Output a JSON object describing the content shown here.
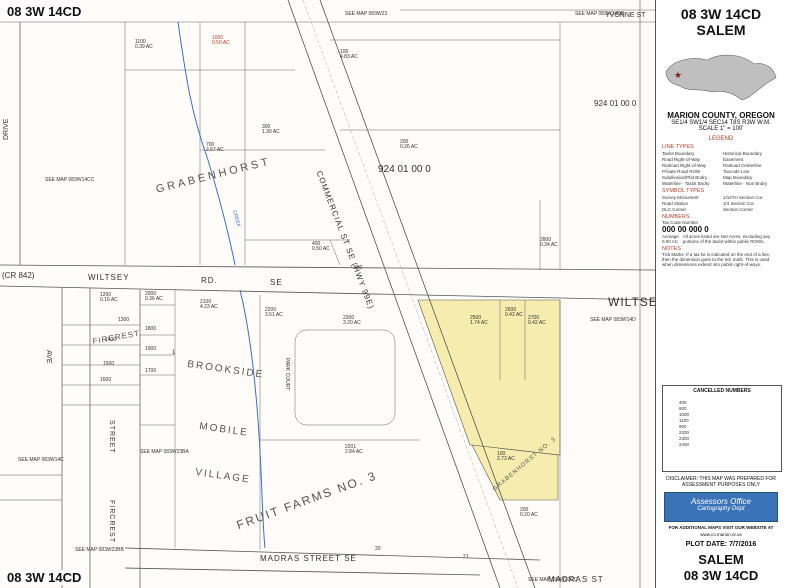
{
  "map_id": "08 3W 14CD",
  "city": "SALEM",
  "county": "MARION COUNTY, OREGON",
  "section_line": "SE1/4 SW1/4 SEC14 T8S R3W W.M.",
  "scale": "SCALE 1\" = 100'",
  "legend_title": "LEGEND",
  "line_types_title": "LINE TYPES",
  "line_types": [
    "Taxlot Boundary",
    "Historical Boundary",
    "Road Right-of-Way",
    "Easement",
    "Railroad Right-of-Way",
    "Railroad Centerline",
    "Private Road ROW",
    "Taxcode Line",
    "Subdivision/Plat Bndry",
    "Map Boundary",
    "Waterline - Taxlot Bndry",
    "Waterline - Non Bndry"
  ],
  "symbol_types_title": "SYMBOL TYPES",
  "symbol_types": [
    "Survey Monument",
    "1/16TH Section Cor",
    "Road Station",
    "1/4 Section Cor",
    "DLC Corner",
    "Section Corner"
  ],
  "numbers_title": "NUMBERS",
  "taxcode_label": "Tax Code Number",
  "taxcode": "000 00 000 0",
  "acreage_label": "Acreage",
  "acreage_sample": "0.00 AC",
  "acreage_note": "All acres listed are Net Acres, excluding any portions of the taxlot within public ROWs.",
  "notes_title": "NOTES",
  "notes_text": "Tick Marks: If a tax lot is indicated on the end of a line, then the dimension goes to the tick mark. This is used when dimensions extend into public right-of-ways.",
  "cancelled_title": "CANCELLED NUMBERS",
  "cancelled": [
    "400",
    "800",
    "1000",
    "1100",
    "900",
    "2200",
    "2300",
    "2400"
  ],
  "disclaimer": "DISCLAIMER: THIS MAP WAS PREPARED FOR ASSESSMENT PURPOSES ONLY",
  "badge_title": "Assessors Office",
  "badge_subtitle": "Cartography Dept",
  "web_note": "FOR ADDITIONAL MAPS VISIT OUR WEBSITE AT",
  "website": "www.co.marion.or.us",
  "plot_date": "PLOT DATE: 7/7/2016",
  "streets": {
    "wiltsey": "WILTSEY",
    "rd": "RD.",
    "se": "SE",
    "wiltse_right": "WILTSE",
    "cr842": "(CR 842)",
    "commercial": "COMMERCIAL ST SE (HWY 99E)",
    "madras": "MADRAS STREET SE",
    "madras_right": "MADRAS ST",
    "fircrest": "FIRCREST",
    "street": "STREET",
    "ave": "AVE",
    "drive": "DRIVE",
    "park_court": "PARK COURT",
    "yvonne": "YVONNE ST",
    "creek": "CREEK"
  },
  "subdivisions": [
    "GRABENHORST",
    "BROOKSIDE",
    "MOBILE",
    "VILLAGE",
    "FRUIT FARMS NO. 3",
    "FIRCREST",
    "GRABENHORST NO. 3"
  ],
  "taxcodes_on_map": [
    "924 01 00 0",
    "924 01 00 0"
  ],
  "lots": [
    {
      "n": "1100",
      "ac": "0.39 AC"
    },
    {
      "n": "1000",
      "ac": "0.50 AC"
    },
    {
      "n": "100",
      "ac": "4.83 AC"
    },
    {
      "n": "300",
      "ac": "1.30 AC"
    },
    {
      "n": "700",
      "ac": "2.67 AC"
    },
    {
      "n": "200",
      "ac": "0.26 AC"
    },
    {
      "n": "400",
      "ac": "0.50 AC"
    },
    {
      "n": "500",
      "ac": ""
    },
    {
      "n": "2800",
      "ac": "0.34 AC"
    },
    {
      "n": "2000",
      "ac": "0.36 AC"
    },
    {
      "n": "2100",
      "ac": "4.23 AC"
    },
    {
      "n": "2200",
      "ac": "3.51 AC"
    },
    {
      "n": "2300",
      "ac": "3.20 AC"
    },
    {
      "n": "2500",
      "ac": "1.74 AC"
    },
    {
      "n": "2600",
      "ac": "0.42 AC"
    },
    {
      "n": "2700",
      "ac": "0.42 AC"
    },
    {
      "n": "1200",
      "ac": "0.16 AC"
    },
    {
      "n": "1300",
      "ac": ""
    },
    {
      "n": "1800",
      "ac": ""
    },
    {
      "n": "1400",
      "ac": ""
    },
    {
      "n": "1500",
      "ac": ""
    },
    {
      "n": "1600",
      "ac": ""
    },
    {
      "n": "1900",
      "ac": ""
    },
    {
      "n": "1700",
      "ac": ""
    },
    {
      "n": "2201",
      "ac": "2.84 AC"
    },
    {
      "n": "100",
      "ac": "2.73 AC"
    },
    {
      "n": "200",
      "ac": "0.20 AC"
    },
    {
      "n": "20",
      "ac": ""
    },
    {
      "n": "21",
      "ac": ""
    },
    {
      "n": "1",
      "ac": ""
    }
  ],
  "see_maps": [
    "SEE MAP 083W14CC",
    "SEE MAP 083W14C",
    "SEE MAP 083W14D",
    "SEE MAP 083W23BA",
    "SEE MAP 083W23BB",
    "SEE MAP 083W14DB",
    "SEE MAP 083W23",
    "SEE MAP 083W23CC"
  ],
  "colors": {
    "highlight": "#f5ecae",
    "road": "#fdfcf8",
    "line": "#555555",
    "creek": "#3b6fd0",
    "accent": "#c0392b"
  }
}
